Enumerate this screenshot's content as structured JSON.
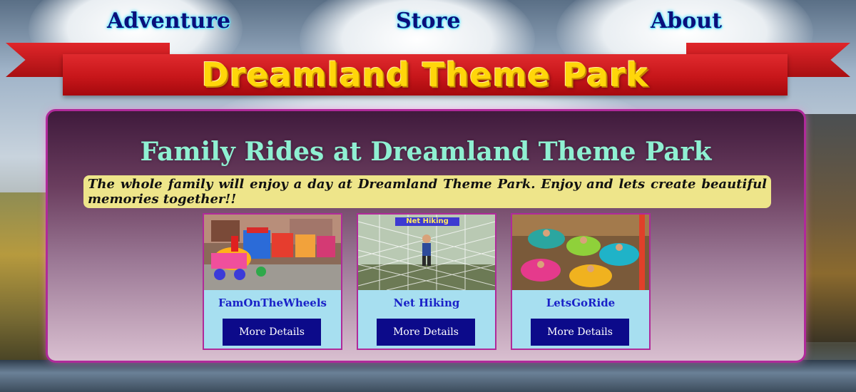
{
  "nav": {
    "adventure": "Adventure",
    "store": "Store",
    "about": "About"
  },
  "banner": {
    "title": "Dreamland Theme Park"
  },
  "main": {
    "title": "Family Rides at Dreamland Theme Park",
    "intro": "The whole family will enjoy a day at Dreamland Theme Park. Enjoy and lets create beautiful memories together!!"
  },
  "cards": [
    {
      "name": "FamOnTheWheels",
      "button": "More Details"
    },
    {
      "name": "Net Hiking",
      "button": "More Details",
      "sign": "Net Hiking"
    },
    {
      "name": "LetsGoRide",
      "button": "More Details"
    }
  ],
  "colors": {
    "nav_text": "#0b0f7a",
    "banner_red": "#c7161a",
    "banner_text": "#ffd60a",
    "panel_border": "#b02a9a",
    "title_text": "#8ff0d2",
    "intro_bg": "#eee58a",
    "card_bg": "#a7dff0",
    "button_bg": "#0c0a8a"
  }
}
